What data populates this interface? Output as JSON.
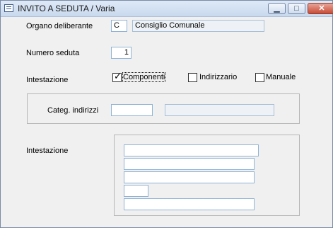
{
  "window": {
    "title": "INVITO A SEDUTA / Varia",
    "minimize_glyph": "▁",
    "maximize_glyph": "□",
    "close_glyph": "✕"
  },
  "form": {
    "organo_label": "Organo deliberante",
    "organo_code": "C",
    "organo_name": "Consiglio Comunale",
    "numero_label": "Numero seduta",
    "numero_value": "1",
    "intestazione_label": "Intestazione",
    "options": [
      {
        "label": "Componenti",
        "checked": true
      },
      {
        "label": "Indirizzario",
        "checked": false
      },
      {
        "label": "Manuale",
        "checked": false
      }
    ],
    "categ_label": "Categ. indirizzi",
    "categ_code": "",
    "categ_desc": "",
    "intestazione2_label": "Intestazione",
    "intestazione_lines": [
      "",
      "",
      "",
      "",
      ""
    ]
  }
}
